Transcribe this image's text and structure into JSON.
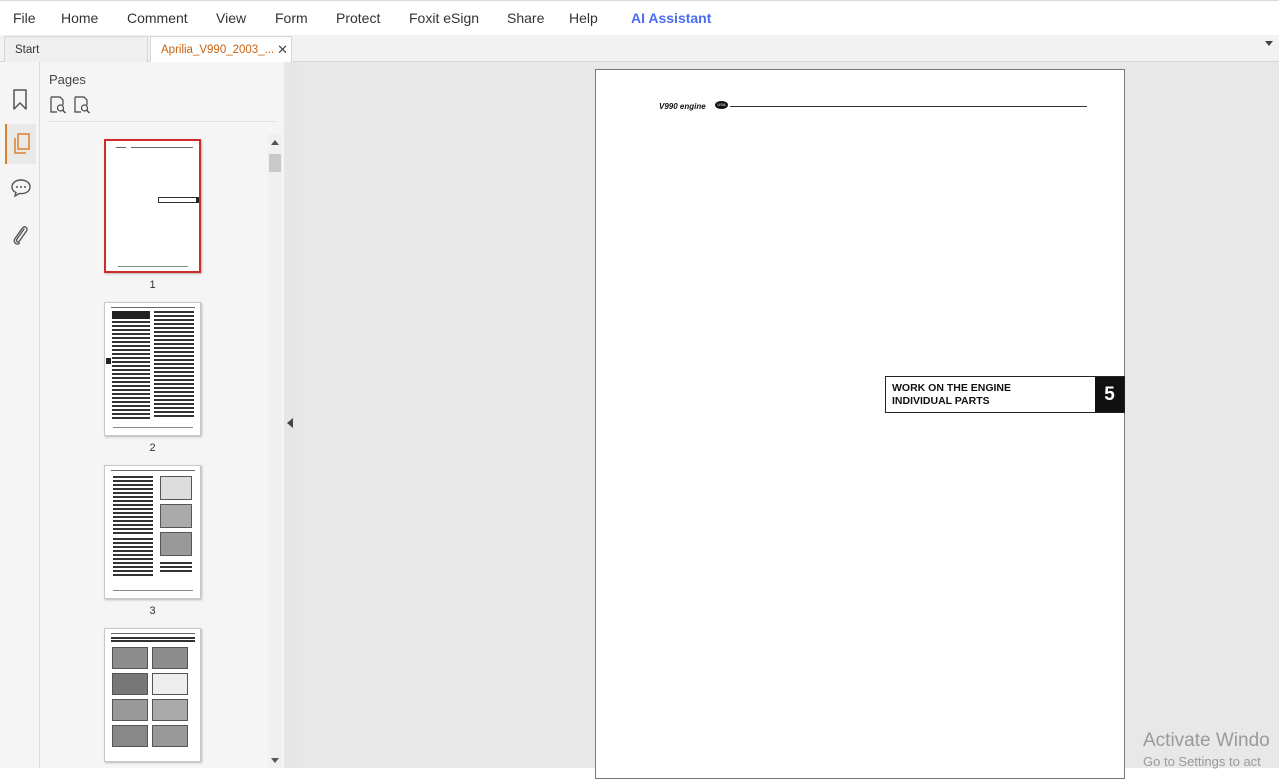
{
  "menu": {
    "file": "File",
    "home": "Home",
    "comment": "Comment",
    "view": "View",
    "form": "Form",
    "protect": "Protect",
    "esign": "Foxit eSign",
    "share": "Share",
    "help": "Help",
    "ai": "AI Assistant"
  },
  "tabs": {
    "start": "Start",
    "document": "Aprilia_V990_2003_..."
  },
  "panel": {
    "title": "Pages",
    "thumbnails": [
      {
        "label": "1"
      },
      {
        "label": "2"
      },
      {
        "label": "3"
      }
    ]
  },
  "page": {
    "header_text": "V990 engine",
    "logo_text": "USA",
    "section_title_line1": "WORK ON THE ENGINE",
    "section_title_line2": "INDIVIDUAL PARTS",
    "section_number": "5"
  },
  "watermark": {
    "line1": "Activate Windo",
    "line2": "Go to Settings to act"
  },
  "icons": {
    "rail": [
      "bookmark-icon",
      "pages-icon",
      "comment-icon",
      "attachment-icon"
    ],
    "panel_tools": [
      "page-zoom-in-icon",
      "page-zoom-out-icon"
    ]
  },
  "colors": {
    "active_tab_text": "#c8620e",
    "ai_assistant": "#4c6cf0",
    "selected_thumbnail_border": "#d02b2b",
    "active_rail_accent": "#d9822b"
  }
}
